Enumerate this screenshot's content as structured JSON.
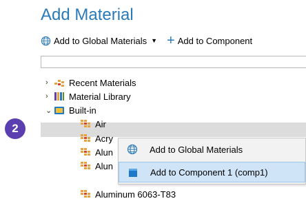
{
  "header": {
    "title": "Add Material"
  },
  "toolbar": {
    "add_global_label": "Add to Global Materials",
    "add_component_label": "Add to Component"
  },
  "search": {
    "value": ""
  },
  "tree": {
    "recent_materials": "Recent Materials",
    "material_library": "Material Library",
    "built_in": "Built-in",
    "items": [
      "Air",
      "Acry",
      "Alun",
      "Alun",
      "Aluminum 6063-T83"
    ]
  },
  "step_badge": "2",
  "context_menu": {
    "items": [
      {
        "label": "Add to Global Materials"
      },
      {
        "label": "Add to Component 1 (comp1)"
      }
    ]
  },
  "colors": {
    "title": "#2a7ab8",
    "badge": "#5b3eb0",
    "menu_highlight": "#cfe4f7",
    "selected_row": "#dcdcdc"
  }
}
